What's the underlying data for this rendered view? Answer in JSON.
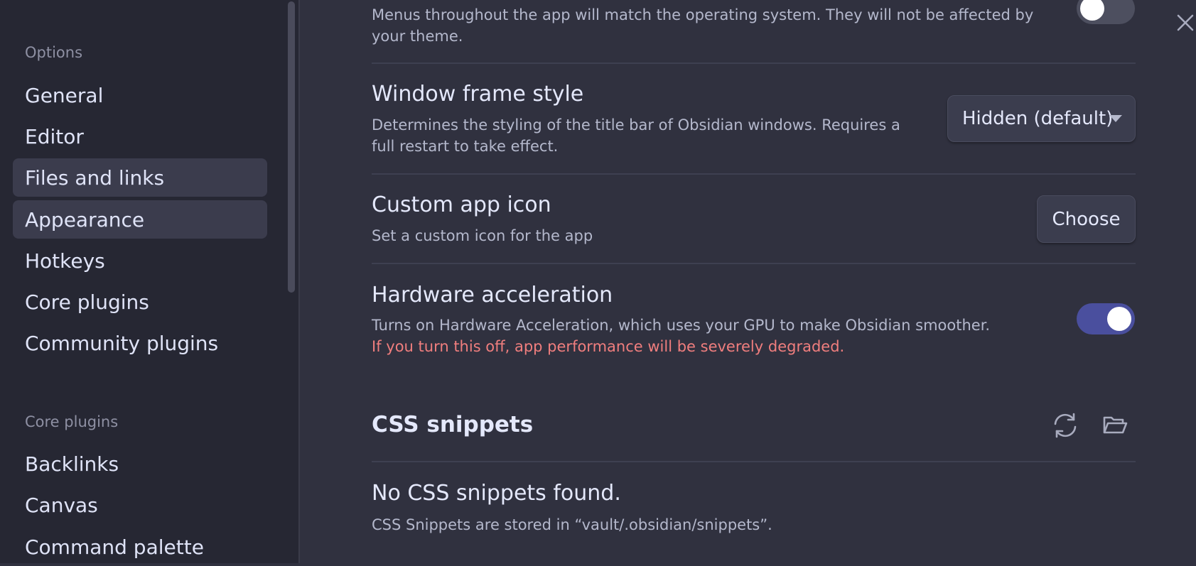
{
  "sidebar": {
    "options_title": "Options",
    "options_items": [
      {
        "label": "General"
      },
      {
        "label": "Editor"
      },
      {
        "label": "Files and links"
      },
      {
        "label": "Appearance"
      },
      {
        "label": "Hotkeys"
      },
      {
        "label": "Core plugins"
      },
      {
        "label": "Community plugins"
      }
    ],
    "core_plugins_title": "Core plugins",
    "core_items": [
      {
        "label": "Backlinks"
      },
      {
        "label": "Canvas"
      },
      {
        "label": "Command palette"
      }
    ]
  },
  "settings": {
    "native_menus": {
      "description": "Menus throughout the app will match the operating system. They will not be affected by your theme.",
      "enabled": false
    },
    "window_frame": {
      "name": "Window frame style",
      "description": "Determines the styling of the title bar of Obsidian windows. Requires a full restart to take effect.",
      "selected": "Hidden (default)"
    },
    "custom_icon": {
      "name": "Custom app icon",
      "description": "Set a custom icon for the app",
      "button": "Choose"
    },
    "hardware_acceleration": {
      "name": "Hardware acceleration",
      "description": "Turns on Hardware Acceleration, which uses your GPU to make Obsidian smoother.",
      "warning": "If you turn this off, app performance will be severely degraded.",
      "enabled": true
    }
  },
  "css_snippets": {
    "heading": "CSS snippets",
    "empty_title": "No CSS snippets found.",
    "empty_description": "CSS Snippets are stored in “vault/.obsidian/snippets”."
  },
  "icons": {
    "close": "close-icon",
    "reload": "reload-icon",
    "folder": "folder-open-icon"
  },
  "colors": {
    "accent_toggle": "#4a4f9e",
    "warning": "#f07e7e"
  }
}
